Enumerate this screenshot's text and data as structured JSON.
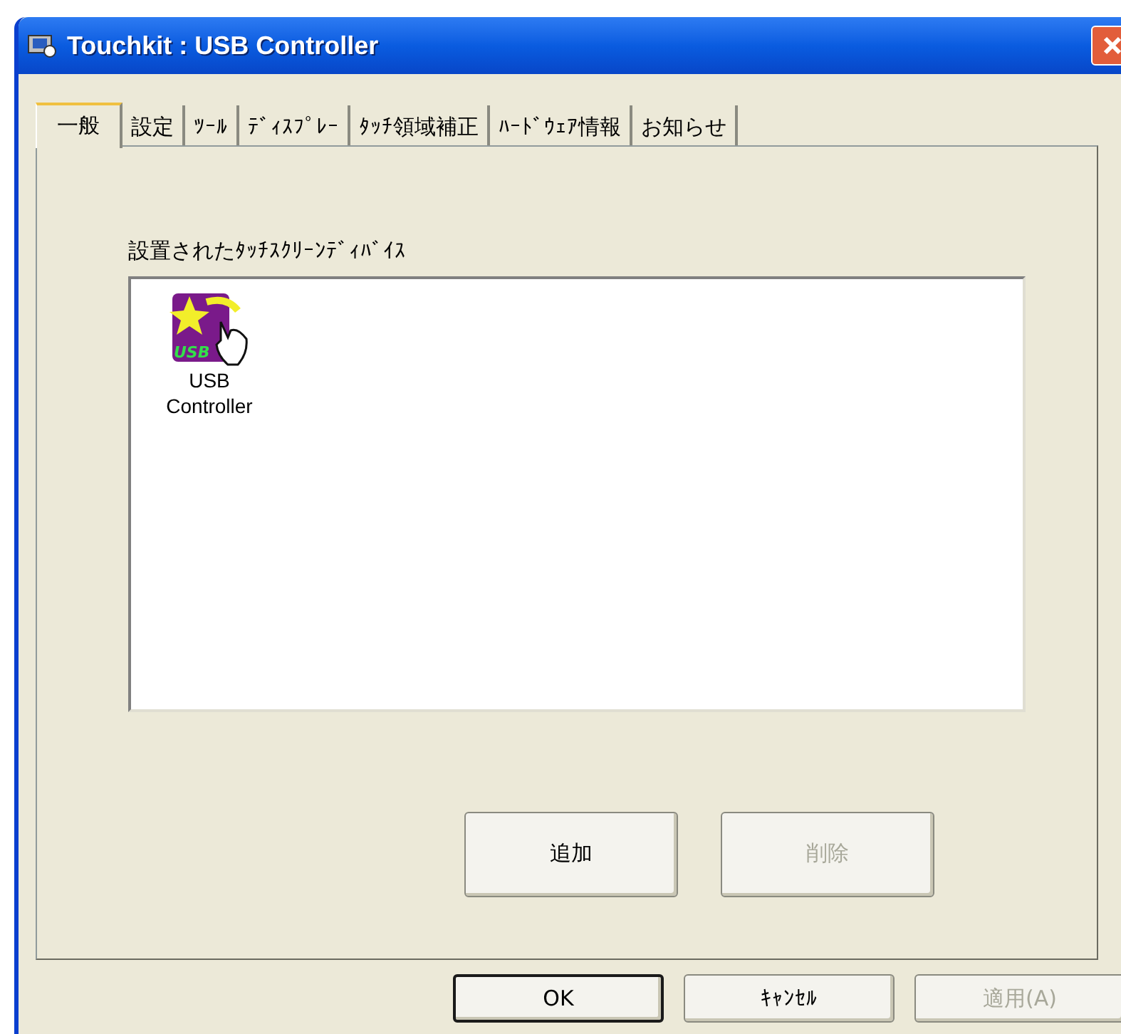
{
  "window": {
    "title": "Touchkit : USB Controller"
  },
  "tabs": [
    {
      "label": "一般",
      "selected": true
    },
    {
      "label": "設定",
      "selected": false
    },
    {
      "label": "ﾂｰﾙ",
      "selected": false
    },
    {
      "label": "ﾃﾞｨｽﾌﾟﾚｰ",
      "selected": false
    },
    {
      "label": "ﾀｯﾁ領域補正",
      "selected": false
    },
    {
      "label": "ﾊｰﾄﾞｳｪｱ情報",
      "selected": false
    },
    {
      "label": "お知らせ",
      "selected": false
    }
  ],
  "devices": {
    "label": "設置されたﾀｯﾁｽｸﾘｰﾝﾃﾞｨﾊﾞｲｽ",
    "items": [
      {
        "name": "USB Controller",
        "icon_text": "USB"
      }
    ]
  },
  "panel_buttons": [
    {
      "label": "追加",
      "disabled": false
    },
    {
      "label": "削除",
      "disabled": true
    }
  ],
  "dialog_buttons": [
    {
      "label": "OK",
      "disabled": false,
      "default": true
    },
    {
      "label": "ｷｬﾝｾﾙ",
      "disabled": false,
      "default": false
    },
    {
      "label": "適用(A)",
      "disabled": true,
      "default": false
    }
  ]
}
